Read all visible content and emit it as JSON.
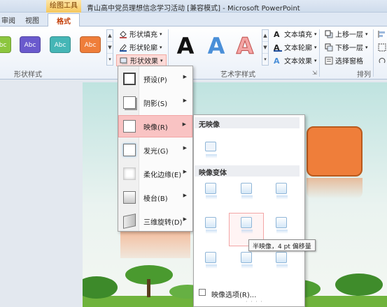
{
  "window": {
    "tool_group": "绘图工具",
    "title": "青山高中党员理想信念学习活动 [兼容模式] - Microsoft PowerPoint"
  },
  "tabs": [
    "审阅",
    "视图",
    "格式"
  ],
  "ribbon": {
    "shape_styles": {
      "label": "形状样式",
      "swatches": [
        {
          "text": "Abc",
          "color": "#8cc63f"
        },
        {
          "text": "Abc",
          "color": "#6a5acd"
        },
        {
          "text": "Abc",
          "color": "#45b6b6"
        },
        {
          "text": "Abc",
          "color": "#ef7e3a"
        }
      ],
      "fill": "形状填充",
      "outline": "形状轮廓",
      "effects": "形状效果"
    },
    "wordart": {
      "label": "艺术字样式",
      "samples": [
        {
          "text": "A",
          "color": "#111111"
        },
        {
          "text": "A",
          "color": "#4a8fd8"
        },
        {
          "text": "A",
          "color": "#f4a4a4"
        }
      ],
      "text_fill": "文本填充",
      "text_outline": "文本轮廓",
      "text_effects": "文本效果"
    },
    "arrange": {
      "label": "排列",
      "bring_forward": "上移一层",
      "send_backward": "下移一层",
      "selection_pane": "选择窗格"
    }
  },
  "effects_menu": {
    "items": [
      {
        "label": "预设(P)"
      },
      {
        "label": "阴影(S)"
      },
      {
        "label": "映像(R)"
      },
      {
        "label": "发光(G)"
      },
      {
        "label": "柔化边缘(E)"
      },
      {
        "label": "棱台(B)"
      },
      {
        "label": "三维旋转(D)"
      }
    ]
  },
  "reflection_submenu": {
    "no_reflection": "无映像",
    "variations": "映像变体",
    "tooltip": "半映像，4 pt 偏移量",
    "options": "映像选项(R)..."
  },
  "colors": {
    "menu_highlight": "#f9c3c3",
    "accent_orange": "#ef7e3a",
    "tab_active": "#c4400a"
  }
}
